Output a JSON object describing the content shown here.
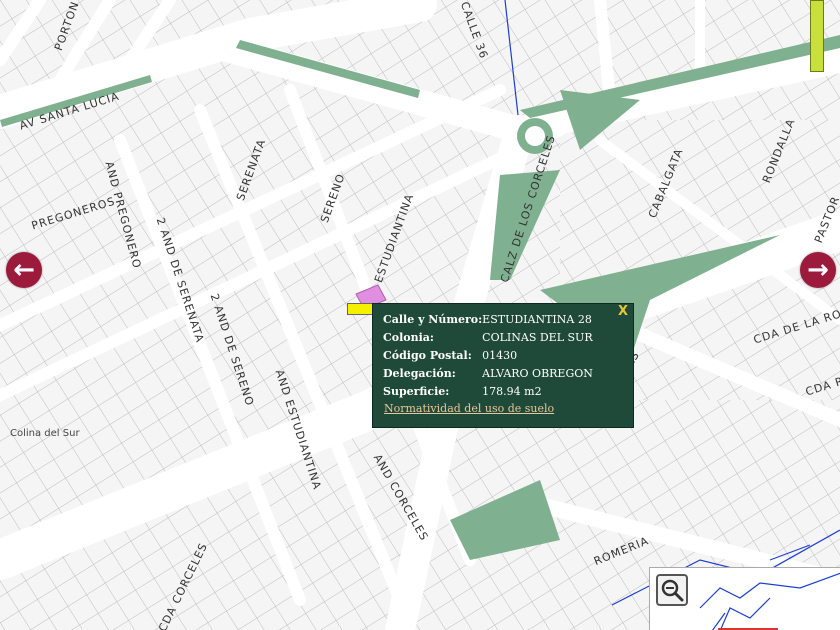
{
  "map": {
    "colors": {
      "background": "#e6e6e6",
      "block": "#f5f5f5",
      "block_line": "#bfbfbf",
      "street": "#ffffff",
      "park": "#7fb08f",
      "water": "#1b3fd6",
      "selected_lot": "#e08fe0"
    },
    "colony_label": "Colina del Sur",
    "streets": [
      {
        "name": "PORTON"
      },
      {
        "name": "AV SANTA LUCIA"
      },
      {
        "name": "CALLE 36"
      },
      {
        "name": "PREGONEROS"
      },
      {
        "name": "AND PREGONERO"
      },
      {
        "name": "2 AND DE SERENATA"
      },
      {
        "name": "SERENATA"
      },
      {
        "name": "SERENO"
      },
      {
        "name": "2 AND DE SERENO"
      },
      {
        "name": "ESTUDIANTINA"
      },
      {
        "name": "AND ESTUDIANTINA"
      },
      {
        "name": "CALZ DE LOS CORCELES"
      },
      {
        "name": "CABALGATA"
      },
      {
        "name": "RONDALLA"
      },
      {
        "name": "PASTOR"
      },
      {
        "name": "CDA DE LA ROM"
      },
      {
        "name": "CDA ROM"
      },
      {
        "name": "CARRETAS"
      },
      {
        "name": "ROMERIA"
      },
      {
        "name": "AND CORCELES"
      },
      {
        "name": "CDA CORCELES"
      }
    ]
  },
  "nav": {
    "prev_icon": "arrow-left-icon",
    "next_icon": "arrow-right-icon",
    "prev_glyph": "←",
    "next_glyph": "→"
  },
  "popup": {
    "close_label": "X",
    "rows": [
      {
        "key": "Calle y Número:",
        "value": "ESTUDIANTINA 28"
      },
      {
        "key": "Colonia:",
        "value": "COLINAS DEL SUR"
      },
      {
        "key": "Código Postal:",
        "value": "01430"
      },
      {
        "key": "Delegación:",
        "value": "ALVARO OBREGON"
      },
      {
        "key": "Superficie:",
        "value": "178.94 m2"
      }
    ],
    "link_label": "Normatividad del uso de suelo"
  },
  "overview": {
    "zoom_icon": "magnifier-icon"
  }
}
